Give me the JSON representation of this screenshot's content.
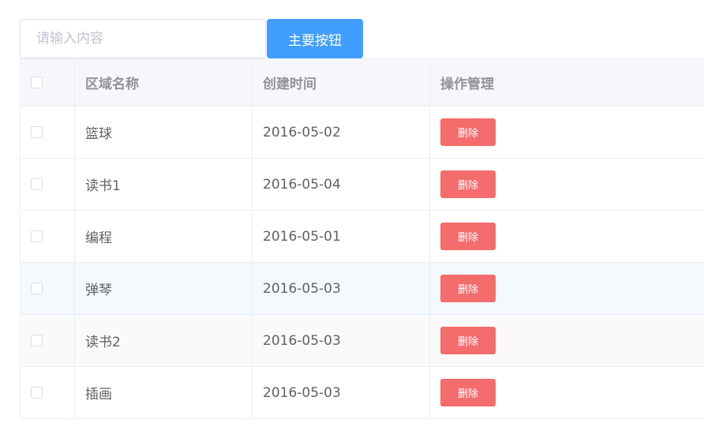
{
  "toolbar": {
    "search_placeholder": "请输入内容",
    "search_value": "",
    "primary_button_label": "主要按钮"
  },
  "table": {
    "columns": [
      "区域名称",
      "创建时间",
      "操作管理"
    ],
    "rows": [
      {
        "name": "篮球",
        "date": "2016-05-02",
        "action": "删除"
      },
      {
        "name": "读书1",
        "date": "2016-05-04",
        "action": "删除"
      },
      {
        "name": "编程",
        "date": "2016-05-01",
        "action": "删除"
      },
      {
        "name": "弹琴",
        "date": "2016-05-03",
        "action": "删除"
      },
      {
        "name": "读书2",
        "date": "2016-05-03",
        "action": "删除"
      },
      {
        "name": "插画",
        "date": "2016-05-03",
        "action": "删除"
      }
    ]
  },
  "colors": {
    "primary": "#409eff",
    "danger": "#f56c6c",
    "header_bg": "#f5f7fa",
    "hover_row_bg": "#f4f9fe",
    "border": "#ebeef5"
  }
}
